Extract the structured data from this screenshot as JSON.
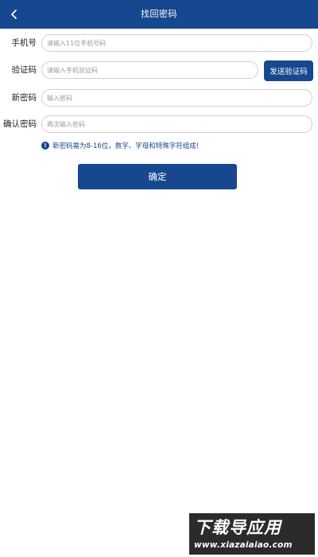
{
  "header": {
    "back_icon": "chevron-left-icon",
    "title": "找回密码"
  },
  "form": {
    "phone": {
      "label": "手机号",
      "placeholder": "请输入11位手机号码"
    },
    "code": {
      "label": "验证码",
      "placeholder": "请输入手机验证码",
      "send_label": "发送验证码"
    },
    "new_password": {
      "label": "新密码",
      "placeholder": "输入密码"
    },
    "confirm_password": {
      "label": "确认密码",
      "placeholder": "再次输入密码"
    }
  },
  "hint": {
    "icon": "info-icon",
    "icon_glyph": "!",
    "text": "新密码需为8-16位，数字、字母和特殊字符组成!"
  },
  "confirm_button": {
    "label": "确定"
  },
  "watermark": {
    "main": "下载导应用",
    "url": "www.xiazaiaiao.com"
  },
  "colors": {
    "primary": "#17478f",
    "input_border": "#cfcfcf",
    "placeholder": "#9a9a9a"
  }
}
